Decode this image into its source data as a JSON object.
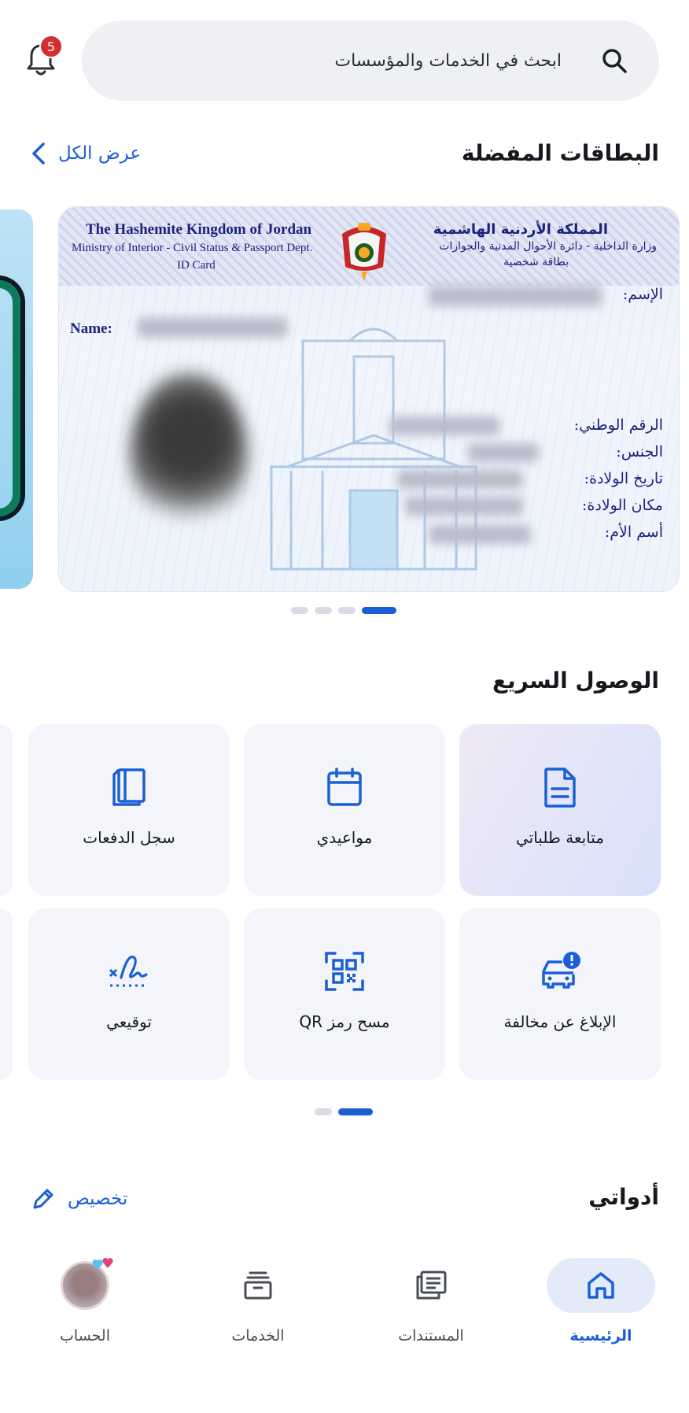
{
  "header": {
    "notification_count": "5",
    "search_placeholder": "ابحث في الخدمات والمؤسسات"
  },
  "favorites": {
    "title": "البطاقات المفضلة",
    "view_all": "عرض الكل"
  },
  "id_card": {
    "en_title": "The Hashemite Kingdom of Jordan",
    "en_ministry": "Ministry of Interior - Civil Status & Passport Dept.",
    "en_card_type": "ID Card",
    "ar_title": "المملكة الأردنية الهاشمية",
    "ar_ministry": "وزارة الداخلية - دائرة الأحوال المدنية والجوازات",
    "ar_card_type": "بطاقة شخصية",
    "name_label_en": "Name:",
    "name_label_ar": "الإسم:",
    "national_no_label": "الرقم الوطني:",
    "gender_label": "الجنس:",
    "dob_label": "تاريخ الولادة:",
    "pob_label": "مكان الولادة:",
    "mother_label": "أسم الأم:"
  },
  "card_carousel": {
    "pages": 4,
    "active_index": 3
  },
  "quick_access": {
    "title": "الوصول السريع",
    "tiles": [
      {
        "label": "متابعة طلباتي",
        "icon": "document-icon"
      },
      {
        "label": "مواعيدي",
        "icon": "calendar-icon"
      },
      {
        "label": "سجل الدفعات",
        "icon": "book-icon"
      },
      {
        "label": "الإبلاغ عن مخالفة",
        "icon": "car-alert-icon"
      },
      {
        "label": "مسح رمز QR",
        "icon": "qr-scan-icon"
      },
      {
        "label": "توقيعي",
        "icon": "signature-icon"
      }
    ],
    "pages": 2,
    "active_index": 1
  },
  "tools": {
    "title": "أدواتي",
    "customize": "تخصيص"
  },
  "nav": {
    "home": "الرئيسية",
    "documents": "المستندات",
    "services": "الخدمات",
    "account": "الحساب"
  },
  "colors": {
    "accent": "#1a5fd6",
    "badge": "#d32f2f",
    "tile_bg": "#f3f5fa"
  }
}
